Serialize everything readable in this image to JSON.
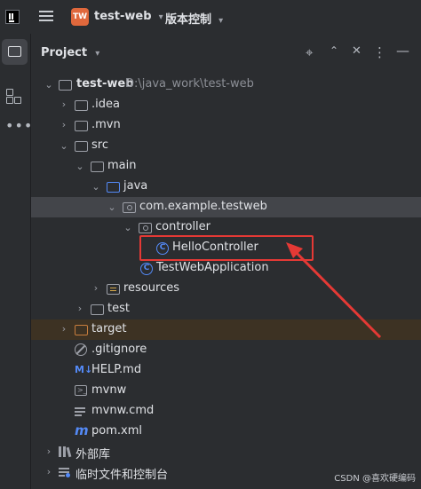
{
  "topbar": {
    "project_badge": "TW",
    "project_name": "test-web",
    "vcs_label": "版本控制"
  },
  "panel": {
    "title": "Project"
  },
  "tree": {
    "root_name": "test-web",
    "root_path": "D:\\java_work\\test-web",
    "idea": ".idea",
    "mvn": ".mvn",
    "src": "src",
    "main": "main",
    "java": "java",
    "package": "com.example.testweb",
    "controller": "controller",
    "hello": "HelloController",
    "app": "TestWebApplication",
    "resources": "resources",
    "test": "test",
    "target": "target",
    "gitignore": ".gitignore",
    "helpmd": "HELP.md",
    "mvnw": "mvnw",
    "mvnwcmd": "mvnw.cmd",
    "pom": "pom.xml",
    "extlib": "外部库",
    "scratch": "临时文件和控制台"
  },
  "watermark": "CSDN @喜欢硬编码",
  "colors": {
    "accent_blue": "#548af7",
    "highlight_red": "#e53935",
    "excluded_orange": "#c77d3d"
  }
}
